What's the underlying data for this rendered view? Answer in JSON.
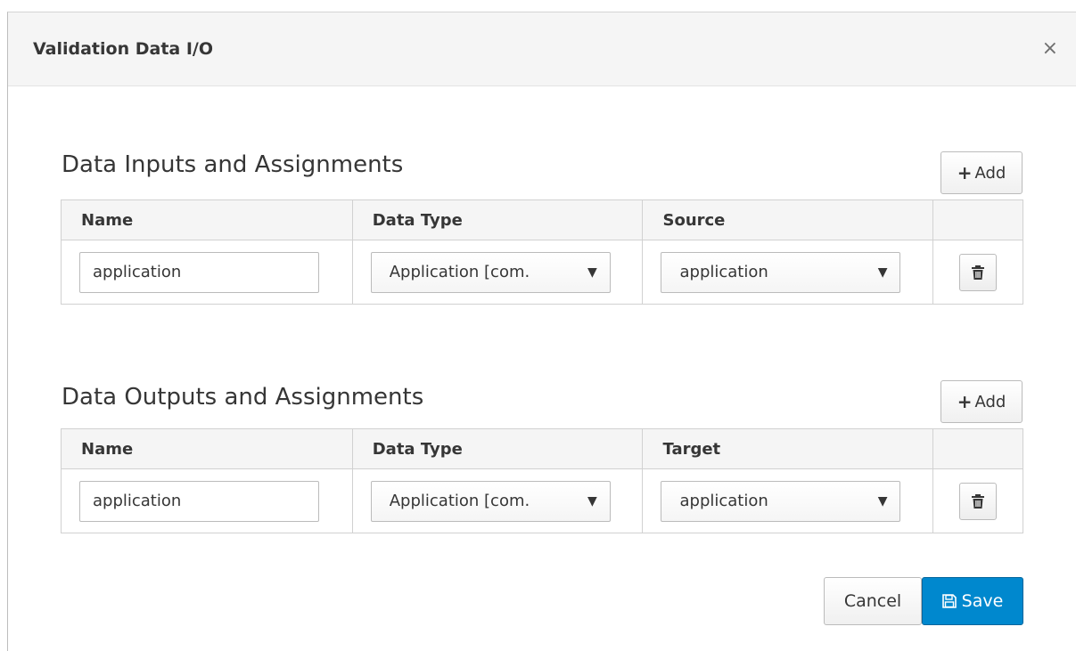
{
  "dialog": {
    "title": "Validation Data I/O",
    "close_glyph": "×"
  },
  "inputs": {
    "section_title": "Data Inputs and Assignments",
    "add_label": "Add",
    "columns": [
      "Name",
      "Data Type",
      "Source"
    ],
    "rows": [
      {
        "name": "application",
        "data_type": "Application [com.",
        "source": "application"
      }
    ]
  },
  "outputs": {
    "section_title": "Data Outputs and Assignments",
    "add_label": "Add",
    "columns": [
      "Name",
      "Data Type",
      "Target"
    ],
    "rows": [
      {
        "name": "application",
        "data_type": "Application [com.",
        "target": "application"
      }
    ]
  },
  "footer": {
    "cancel_label": "Cancel",
    "save_label": "Save"
  },
  "colors": {
    "primary": "#0088ce",
    "header_bg": "#f5f5f5"
  },
  "icons": {
    "add": "plus-icon",
    "delete": "trash-icon",
    "save": "floppy-icon",
    "dropdown": "caret-down-icon",
    "close": "close-icon"
  }
}
